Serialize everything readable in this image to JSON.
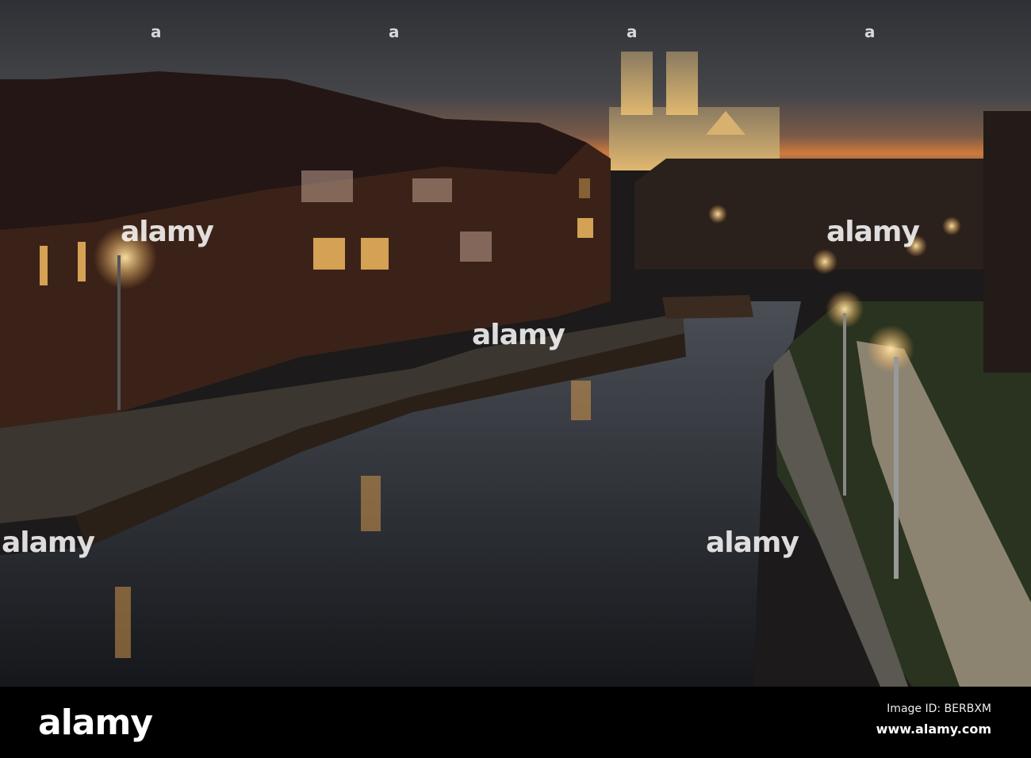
{
  "watermark": {
    "word": "alamy",
    "mark": "a"
  },
  "footer": {
    "logo": "alamy",
    "image_id": "Image ID: BERBXM",
    "site": "www.alamy.com"
  },
  "colors": {
    "sky": "#3a3b3f",
    "sunset": "#c8733a",
    "brick": "#3a2218",
    "lamp": "#ffcf7a",
    "water": "#2a2d33"
  }
}
